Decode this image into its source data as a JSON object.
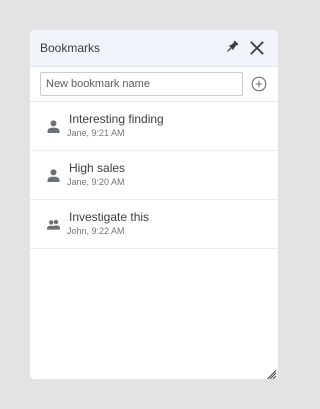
{
  "panel": {
    "title": "Bookmarks",
    "pin_icon": "pin-icon",
    "close_icon": "close-icon"
  },
  "add_bookmark": {
    "placeholder": "New bookmark name",
    "value": "",
    "add_icon": "add-circle-icon"
  },
  "bookmarks": [
    {
      "title": "Interesting finding",
      "author": "Jane",
      "time": "9:21 AM",
      "meta": "Jane, 9:21 AM",
      "icon": "user-icon"
    },
    {
      "title": "High sales",
      "author": "Jane",
      "time": "9:20 AM",
      "meta": "Jane, 9:20 AM",
      "icon": "user-icon"
    },
    {
      "title": "Investigate this",
      "author": "John",
      "time": "9:22 AM",
      "meta": "John, 9:22 AM",
      "icon": "users-icon"
    }
  ],
  "colors": {
    "header_background": "#f1f4fb",
    "page_background": "#e3e3e3",
    "icon_gray": "#6e7078",
    "text_dark": "#3b3d44"
  }
}
